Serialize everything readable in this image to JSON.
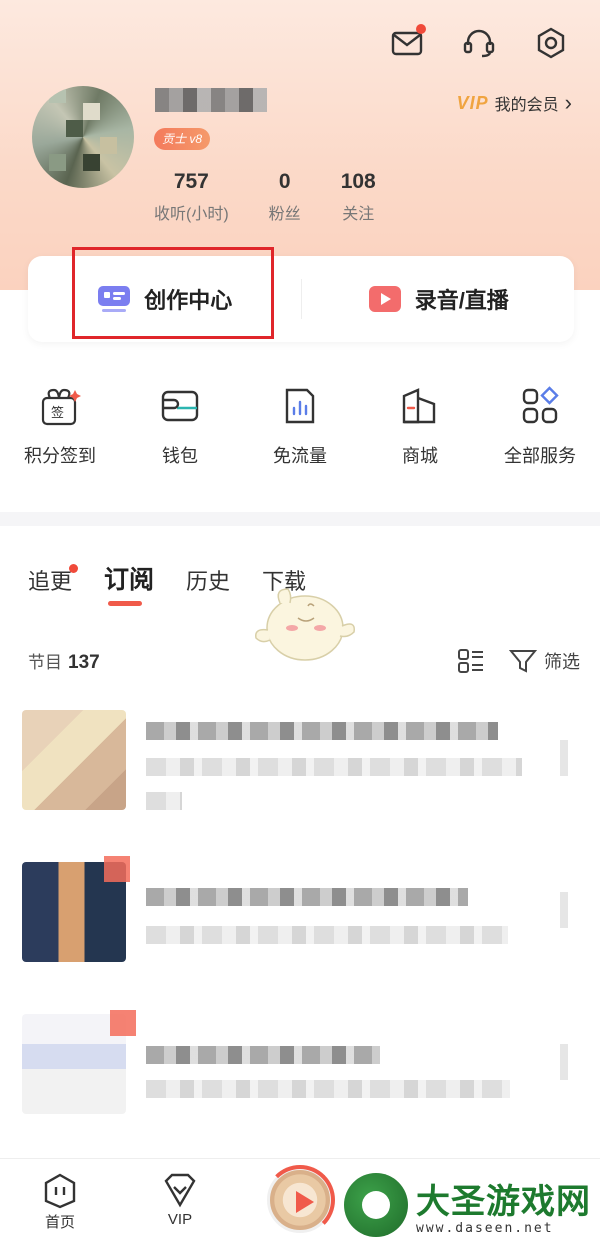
{
  "header": {
    "icons": [
      "mail-icon",
      "headset-icon",
      "settings-icon"
    ],
    "badge": "贡士 v8",
    "vip": {
      "tag": "VIP",
      "label": "我的会员",
      "arrow": "›"
    },
    "stats": [
      {
        "value": "757",
        "label": "收听(小时)"
      },
      {
        "value": "0",
        "label": "粉丝"
      },
      {
        "value": "108",
        "label": "关注"
      }
    ]
  },
  "create": {
    "left": "创作中心",
    "right": "录音/直播"
  },
  "services": [
    {
      "label": "积分签到",
      "icon": "sign-in-icon"
    },
    {
      "label": "钱包",
      "icon": "wallet-icon"
    },
    {
      "label": "免流量",
      "icon": "data-free-icon"
    },
    {
      "label": "商城",
      "icon": "mall-icon"
    },
    {
      "label": "全部服务",
      "icon": "all-services-icon"
    }
  ],
  "tabs": [
    {
      "label": "追更",
      "dot": true
    },
    {
      "label": "订阅",
      "active": true
    },
    {
      "label": "历史"
    },
    {
      "label": "下载"
    }
  ],
  "list": {
    "count_label": "节目",
    "count": "137",
    "filter_label": "筛选"
  },
  "bottom_nav": [
    {
      "label": "首页",
      "icon": "home-icon"
    },
    {
      "label": "VIP",
      "icon": "vip-diamond-icon"
    }
  ],
  "watermark": {
    "main": "大圣游戏网",
    "sub": "www.daseen.net"
  },
  "colors": {
    "accent": "#f05a4a",
    "highlight_box": "#e0262a",
    "vip": "#f0a440"
  }
}
